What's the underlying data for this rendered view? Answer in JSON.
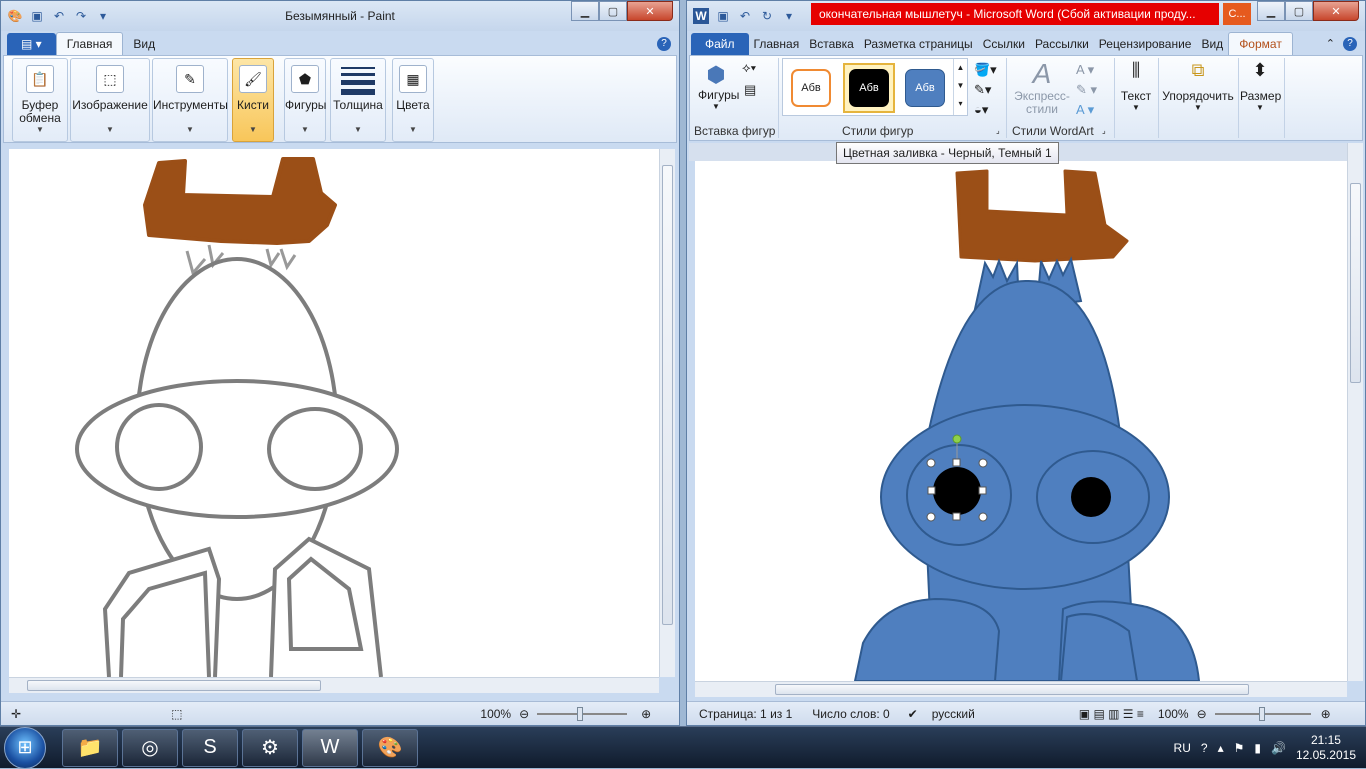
{
  "paint": {
    "title": "Безымянный - Paint",
    "tabs": [
      "Главная",
      "Вид"
    ],
    "groups": [
      {
        "label1": "Буфер",
        "label2": "обмена"
      },
      {
        "label1": "Изображение",
        "label2": ""
      },
      {
        "label1": "Инструменты",
        "label2": ""
      },
      {
        "label1": "Кисти",
        "label2": ""
      },
      {
        "label1": "Фигуры",
        "label2": ""
      },
      {
        "label1": "Толщина",
        "label2": ""
      },
      {
        "label1": "Цвета",
        "label2": ""
      }
    ],
    "zoom": "100%"
  },
  "word": {
    "title_highlight": "окончательная мышлетуч",
    "title": "- Microsoft Word (Сбой активации проду...",
    "extra_tab": "С...",
    "file_tab": "Файл",
    "tabs": [
      "Главная",
      "Вставка",
      "Разметка страницы",
      "Ссылки",
      "Рассылки",
      "Рецензирование",
      "Вид",
      "Формат"
    ],
    "groups": {
      "insert_shapes": "Вставка фигур",
      "shapes_btn": "Фигуры",
      "shape_styles": "Стили фигур",
      "style_sample": "Абв",
      "wordart_styles": "Стили WordArt",
      "express_styles1": "Экспресс-",
      "express_styles2": "стили",
      "text": "Текст",
      "arrange": "Упорядочить",
      "size": "Размер"
    },
    "tooltip": "Цветная заливка - Черный, Темный 1",
    "status": {
      "page": "Страница: 1 из 1",
      "words": "Число слов: 0",
      "language": "русский",
      "zoom": "100%"
    }
  },
  "taskbar": {
    "lang": "RU",
    "time": "21:15",
    "date": "12.05.2015"
  },
  "colors": {
    "brown": "#9b4f17",
    "blue": "#4f7fbf",
    "outline": "#2f5a8f",
    "gray_line": "#7d7d7d"
  }
}
